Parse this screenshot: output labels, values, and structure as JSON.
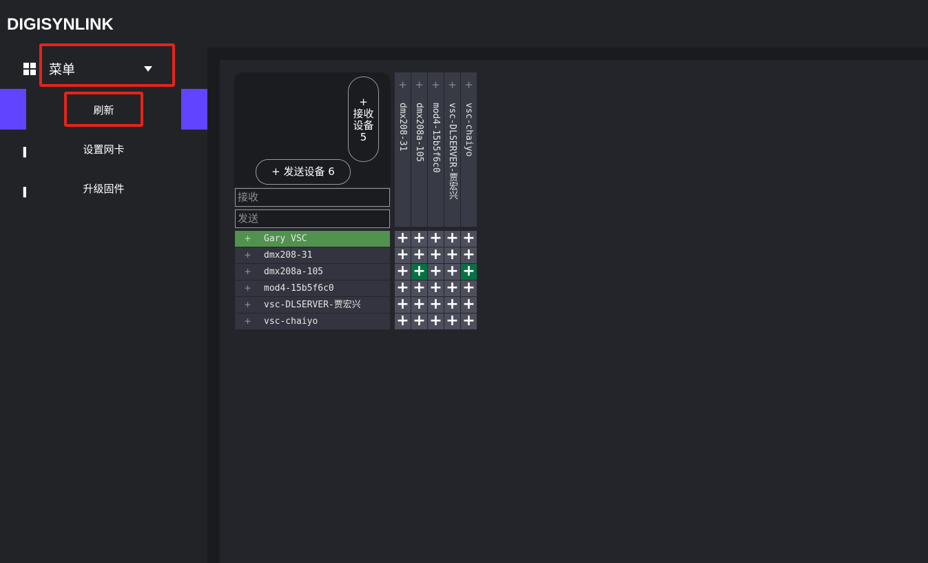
{
  "app": {
    "title": "DIGISYNLINK"
  },
  "sidebar": {
    "menu_label": "菜单",
    "dropdown": {
      "items": [
        "刷新",
        "设置网卡",
        "升级固件"
      ]
    }
  },
  "matrix": {
    "receive_button": {
      "plus": "+",
      "label": "接收设备",
      "count": "5"
    },
    "send_button": {
      "label": "+ 发送设备 6"
    },
    "filters": {
      "receive_placeholder": "接收",
      "send_placeholder": "发送"
    },
    "row_plus": "+",
    "col_plus": "+",
    "cell_symbol": "+",
    "receivers": [
      "dmx208-31",
      "dmx208a-105",
      "mod4-15b5f6c0",
      "vsc-DLSERVER-贾宏兴",
      "vsc-chaiyo"
    ],
    "senders": [
      "Gary VSC",
      "dmx208-31",
      "dmx208a-105",
      "mod4-15b5f6c0",
      "vsc-DLSERVER-贾宏兴",
      "vsc-chaiyo"
    ],
    "selected_sender": "Gary VSC",
    "routes_active": [
      {
        "sender": "dmx208a-105",
        "receiver": "dmx208a-105"
      },
      {
        "sender": "dmx208a-105",
        "receiver": "vsc-chaiyo"
      }
    ]
  },
  "colors": {
    "accent": "#6144ff",
    "highlight_box": "#e8231b",
    "selected_row": "#51924f",
    "active_route": "#057244"
  }
}
